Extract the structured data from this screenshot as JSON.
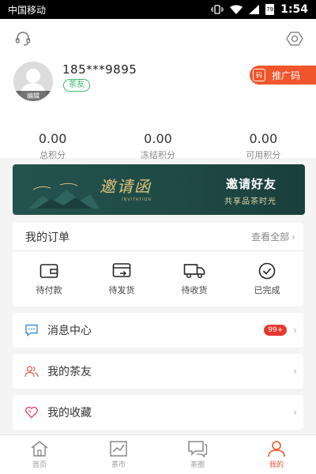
{
  "status_bar": {
    "carrier": "中国移动",
    "time": "1:54",
    "battery": "79"
  },
  "profile": {
    "phone": "185***9895",
    "tag": "茶友",
    "avatar_edit": "编辑",
    "promo_icon": "码",
    "promo_label": "推广码"
  },
  "points": [
    {
      "value": "0.00",
      "label": "总积分"
    },
    {
      "value": "0.00",
      "label": "冻结积分"
    },
    {
      "value": "0.00",
      "label": "可用积分"
    }
  ],
  "banner": {
    "art_title": "邀请函",
    "art_sub": "INVITATION",
    "title": "邀请好友",
    "subtitle": "共享品茶时光"
  },
  "orders": {
    "title": "我的订单",
    "view_all": "查看全部",
    "items": [
      {
        "label": "待付款",
        "icon": "wallet-icon"
      },
      {
        "label": "待发货",
        "icon": "card-out-icon"
      },
      {
        "label": "待收货",
        "icon": "truck-icon"
      },
      {
        "label": "已完成",
        "icon": "check-circle-icon"
      }
    ]
  },
  "menu": [
    {
      "label": "消息中心",
      "icon": "message-icon",
      "badge": "99+"
    },
    {
      "label": "我的茶友",
      "icon": "friends-icon"
    },
    {
      "label": "我的收藏",
      "icon": "heart-icon"
    }
  ],
  "tabs": [
    {
      "label": "首页",
      "icon": "home-icon"
    },
    {
      "label": "茶市",
      "icon": "chart-icon"
    },
    {
      "label": "茶圈",
      "icon": "chat-icon"
    },
    {
      "label": "我的",
      "icon": "person-icon",
      "active": true
    }
  ],
  "colors": {
    "accent": "#f0552b",
    "green_tag": "#3dba6b",
    "badge_red": "#e8382e",
    "banner_bg": "#24534f"
  }
}
